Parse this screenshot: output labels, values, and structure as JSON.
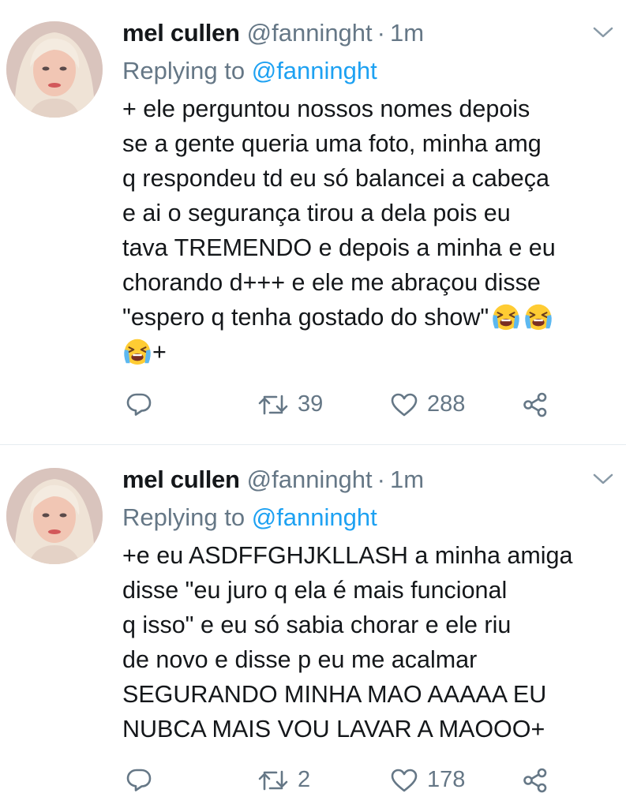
{
  "tweets": [
    {
      "name": "mel cullen",
      "handle": "@fanninght",
      "separator": "·",
      "time": "1m",
      "reply_prefix": "Replying to",
      "reply_handle": "@fanninght",
      "lines": [
        "+ ele perguntou nossos nomes depois",
        "se a gente queria uma foto, minha amg",
        "q respondeu td eu só balancei a cabeça",
        "e ai o segurança tirou a dela pois eu",
        "tava TREMENDO e depois a minha e eu",
        "chorando d+++ e ele me abraçou disse",
        "\"espero q tenha gostado do show\"",
        "+"
      ],
      "retweets": "39",
      "likes": "288",
      "icons": [
        "reply-icon",
        "retweet-icon",
        "like-icon",
        "share-icon",
        "crying-emoji"
      ]
    },
    {
      "name": "mel cullen",
      "handle": "@fanninght",
      "separator": "·",
      "time": "1m",
      "reply_prefix": "Replying to",
      "reply_handle": "@fanninght",
      "lines": [
        "+e eu ASDFFGHJKLLASH a minha amiga",
        "disse \"eu juro q ela é mais funcional",
        "q isso\" e eu só sabia chorar e ele riu",
        "de novo e disse p eu me acalmar",
        "SEGURANDO MINHA MAO AAAAA EU",
        "NUBCA MAIS VOU LAVAR A MAOOO+"
      ],
      "retweets": "2",
      "likes": "178",
      "icons": [
        "reply-icon",
        "retweet-icon",
        "like-icon",
        "share-icon"
      ]
    }
  ],
  "colors": {
    "text": "#14171a",
    "muted": "#657786",
    "link": "#1da1f2",
    "divider": "#e6ecf0"
  }
}
